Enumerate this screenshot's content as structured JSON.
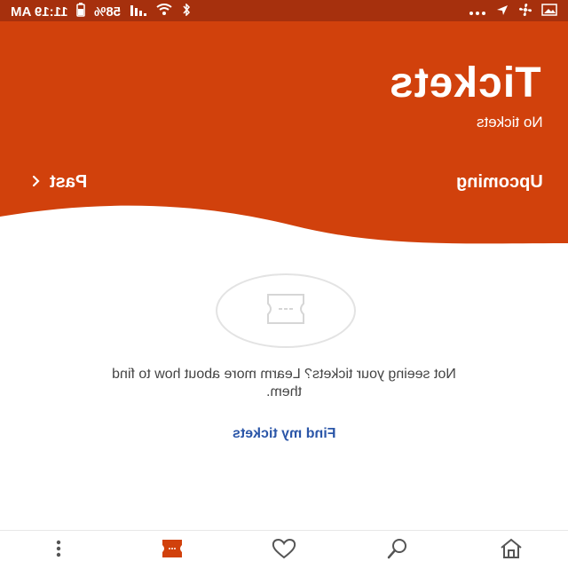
{
  "status_bar": {
    "time": "11:19 AM",
    "battery": "58%",
    "icons": [
      "battery-icon",
      "signal-icon",
      "wifi-icon",
      "bluetooth-icon",
      "more-icon",
      "sync-icon",
      "fan-icon",
      "image-icon"
    ]
  },
  "header": {
    "title": "Tickets",
    "subtitle": "No tickets",
    "tabs": [
      {
        "label": "Upcoming",
        "active": true
      },
      {
        "label": "Past",
        "active": false
      }
    ]
  },
  "empty_state": {
    "icon": "ticket-icon",
    "message": "Not seeing your tickets? Learm more about how to find them.",
    "link_label": "Find my tickets"
  },
  "bottom_nav": {
    "items": [
      "home-icon",
      "search-icon",
      "heart-icon",
      "ticket-icon",
      "more-icon"
    ],
    "active": "ticket-icon"
  },
  "colors": {
    "brand": "#d1410c",
    "status_bar": "#a6300d",
    "link": "#2b56a8"
  }
}
